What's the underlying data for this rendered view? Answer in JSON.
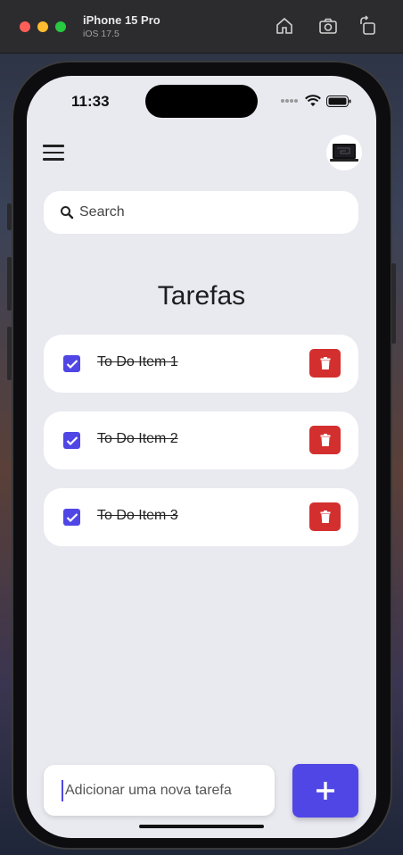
{
  "simulator": {
    "device": "iPhone 15 Pro",
    "os": "iOS 17.5"
  },
  "status_bar": {
    "time": "11:33"
  },
  "search": {
    "placeholder": "Search"
  },
  "page": {
    "title": "Tarefas"
  },
  "todos": [
    {
      "label": "To Do Item 1",
      "done": true
    },
    {
      "label": "To Do Item 2",
      "done": true
    },
    {
      "label": "To Do Item 3",
      "done": true
    }
  ],
  "add": {
    "placeholder": "Adicionar uma nova tarefa"
  },
  "colors": {
    "accent": "#5046e5",
    "delete": "#d32f2f",
    "background": "#e9e9f0"
  },
  "icons": {
    "menu": "hamburger-icon",
    "search": "search-icon",
    "delete": "trash-icon",
    "add": "plus-icon",
    "check": "checkmark-icon"
  }
}
